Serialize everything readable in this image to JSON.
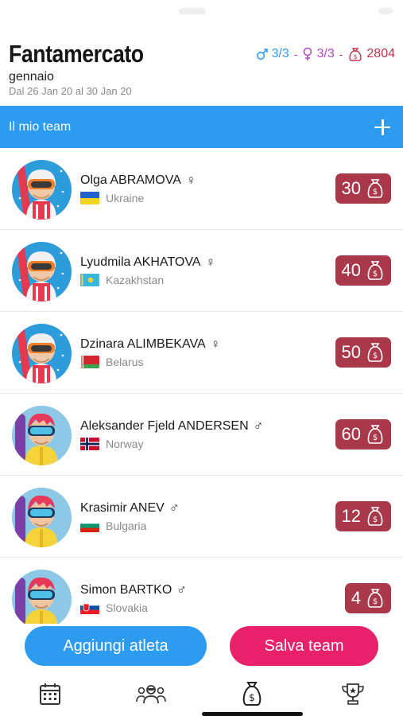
{
  "header": {
    "title": "Fantamercato",
    "subtitle": "gennaio",
    "dates": "Dal 26 Jan 20 al 30 Jan 20",
    "male_count": "3/3",
    "female_count": "3/3",
    "budget": "2804",
    "separator": "-"
  },
  "team_bar": {
    "label": "Il mio team",
    "add_icon": "plus-icon"
  },
  "athletes": [
    {
      "name": "Olga ABRAMOVA",
      "gender": "♀",
      "country": "Ukraine",
      "price": "30",
      "avatar": "female-skier"
    },
    {
      "name": "Lyudmila AKHATOVA",
      "gender": "♀",
      "country": "Kazakhstan",
      "price": "40",
      "avatar": "female-skier"
    },
    {
      "name": "Dzinara ALIMBEKAVA",
      "gender": "♀",
      "country": "Belarus",
      "price": "50",
      "avatar": "female-skier"
    },
    {
      "name": "Aleksander Fjeld ANDERSEN",
      "gender": "♂",
      "country": "Norway",
      "price": "60",
      "avatar": "male-skier"
    },
    {
      "name": "Krasimir ANEV",
      "gender": "♂",
      "country": "Bulgaria",
      "price": "12",
      "avatar": "male-skier"
    },
    {
      "name": "Simon BARTKO",
      "gender": "♂",
      "country": "Slovakia",
      "price": "4",
      "avatar": "male-skier"
    }
  ],
  "actions": {
    "add_label": "Aggiungi atleta",
    "save_label": "Salva team"
  },
  "tabs": [
    {
      "icon": "calendar-icon"
    },
    {
      "icon": "athletes-icon"
    },
    {
      "icon": "money-bag-icon",
      "active": true
    },
    {
      "icon": "trophy-icon"
    }
  ],
  "colors": {
    "primary": "#2c9bf0",
    "accent": "#e8216a",
    "price_badge": "#a9384a",
    "male": "#2f9df0",
    "female": "#b04bc4",
    "budget": "#c0334d"
  }
}
